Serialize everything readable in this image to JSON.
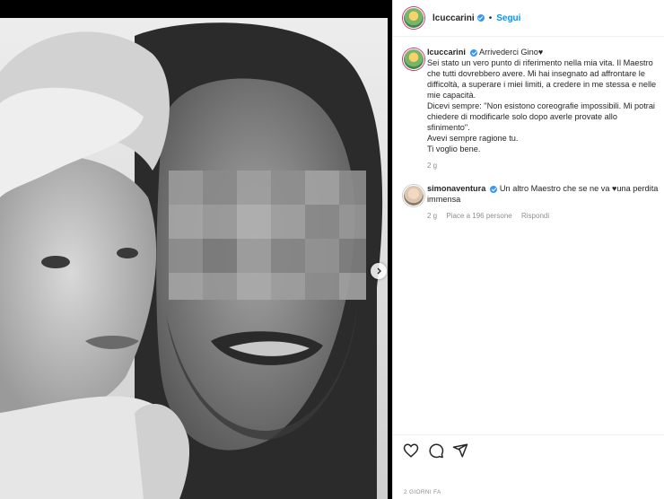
{
  "post": {
    "username": "lcuccarini",
    "follow_label": "Segui",
    "separator": "•"
  },
  "caption": {
    "username": "lcuccarini",
    "text_title": "Arrivederci Gino",
    "lines": [
      "Sei stato un vero punto di riferimento nella mia vita. Il Maestro",
      "che tutti dovrebbero avere. Mi hai insegnato ad affrontare le",
      "difficoltà, a superare i miei limiti, a credere in me stessa e nelle",
      "mie capacità.",
      "Dicevi sempre: \"Non esistono coreografie impossibili. Mi potrai",
      "chiedere di modificarle solo dopo averle provate allo sfinimento\".",
      "Avevi sempre ragione tu.",
      "Ti voglio bene."
    ],
    "time": "2 g"
  },
  "comment": {
    "username": "simonaventura",
    "text_a": "Un altro Maestro che se ne va",
    "text_b": "una perdita",
    "text_c": "immensa",
    "time": "2 g",
    "likes": "Piace a 196 persone",
    "reply": "Rispondi"
  },
  "footer": {
    "date_label": "2 GIORNI FA"
  },
  "icons": {
    "verified": "verified-badge-icon",
    "heart": "heart-icon",
    "comment": "comment-icon",
    "share": "share-icon",
    "next": "chevron-right-icon"
  },
  "colors": {
    "accent": "#0095f6",
    "verified": "#3897f0",
    "text": "#262626",
    "muted": "#8e8e8e"
  }
}
